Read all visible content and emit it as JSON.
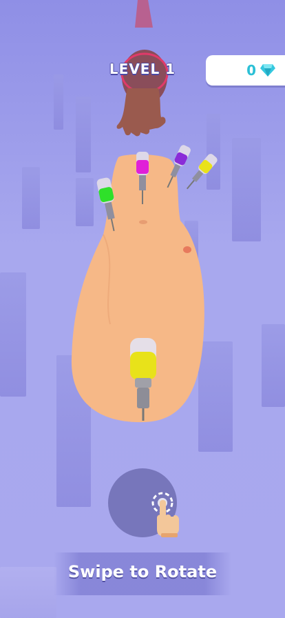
{
  "hud": {
    "level_text": "LEVEL 1",
    "gem_count": "0",
    "gem_icon": "diamond-icon",
    "gem_color": "#2cc0d6"
  },
  "hint": {
    "instruction": "Swipe to Rotate",
    "icon": "tap-hand-icon"
  },
  "scene": {
    "background_color": "#a8a7ee",
    "skin_color": "#f6b887",
    "syringe_colors": [
      "#e020d8",
      "#8a2cd8",
      "#e9e21a",
      "#2fe02a",
      "#e8e21a"
    ]
  }
}
